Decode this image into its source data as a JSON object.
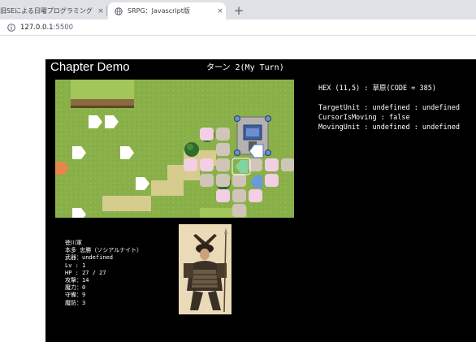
{
  "browser": {
    "tabs": [
      {
        "title": "旧SEによる日曜プログラミング",
        "close": "×"
      },
      {
        "title": "SRPG：Javascript版",
        "close": "×"
      }
    ],
    "new_tab": "+",
    "url_host": "127.0.0.1",
    "url_port": ":5500"
  },
  "game": {
    "chapter_title": "Chapter Demo",
    "turn_text": "ターン 2(My Turn)",
    "info": {
      "hex": "HEX (11,5) : 草原(CODE = 385)",
      "target_unit": "TargetUnit : undefined : undefined",
      "cursor_moving": "CursorIsMoving : false",
      "moving_unit": "MovingUnit : undefined : undefined"
    },
    "unit_status": {
      "army": "徳川軍",
      "name": "本多 忠勝（ソシアルナイト）",
      "weapon": "武器：undefined",
      "level": "Lv : 1",
      "hp": "HP  : 27 / 27",
      "attack": "攻撃：14",
      "magic": "魔力：0",
      "defense": "守備：9",
      "resistance": "魔防：3"
    },
    "colors": {
      "grass": "#8ab04a",
      "road": "#d6cc8e",
      "move_range": "#f2cfe4",
      "stone": "#d0c5b8",
      "enemy_marker": "#e8854a",
      "ally_marker": "#ffffff",
      "cursor": "#7fd8a8",
      "selected": "#6a9ad8"
    }
  }
}
